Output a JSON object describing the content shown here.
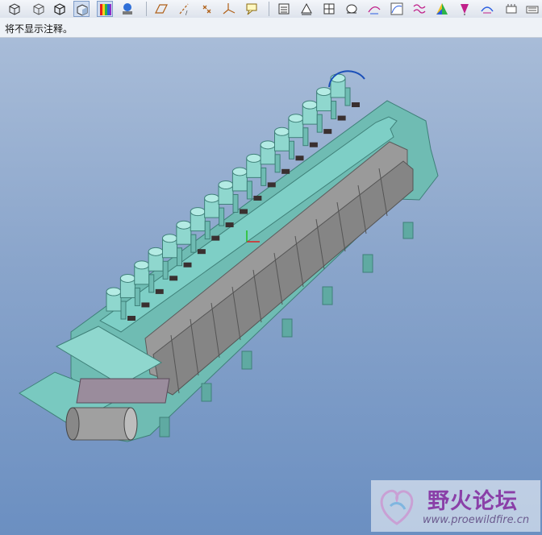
{
  "toolbar": {
    "icons": [
      {
        "name": "view-wireframe-icon",
        "selected": false
      },
      {
        "name": "view-hidden-line-icon",
        "selected": false
      },
      {
        "name": "view-no-hidden-icon",
        "selected": false
      },
      {
        "name": "view-shaded-icon",
        "selected": true
      },
      {
        "name": "appearance-colors-icon",
        "selected": true
      },
      {
        "name": "appearance-gallery-icon",
        "selected": false
      },
      {
        "name": "datum-planes-icon",
        "selected": false
      },
      {
        "name": "datum-axes-icon",
        "selected": false
      },
      {
        "name": "datum-points-icon",
        "selected": false
      },
      {
        "name": "coordinate-systems-icon",
        "selected": false
      },
      {
        "name": "annotations-icon",
        "selected": false
      },
      {
        "name": "measure-icon",
        "selected": false
      },
      {
        "name": "mass-properties-icon",
        "selected": false
      },
      {
        "name": "section-icon",
        "selected": false
      },
      {
        "name": "draft-check-icon",
        "selected": false
      },
      {
        "name": "curvature-icon",
        "selected": false
      },
      {
        "name": "graph-analysis-icon",
        "selected": false
      },
      {
        "name": "shaded-curvature-icon",
        "selected": false
      },
      {
        "name": "reflection-icon",
        "selected": false
      },
      {
        "name": "offset-analysis-icon",
        "selected": false
      },
      {
        "name": "slope-icon",
        "selected": false
      }
    ]
  },
  "message": {
    "text": "将不显示注释。"
  },
  "watermark": {
    "title": "野火论坛",
    "url": "www.proewildfire.cn"
  },
  "colors": {
    "model": "#74c6bd",
    "model_dark": "#4c9a93",
    "panel": "#8f8f8f",
    "roller": "#9a9a9a",
    "cable": "#1b4fb8",
    "viewport_top": "#a8bcd8",
    "viewport_bottom": "#6b8fc1"
  }
}
